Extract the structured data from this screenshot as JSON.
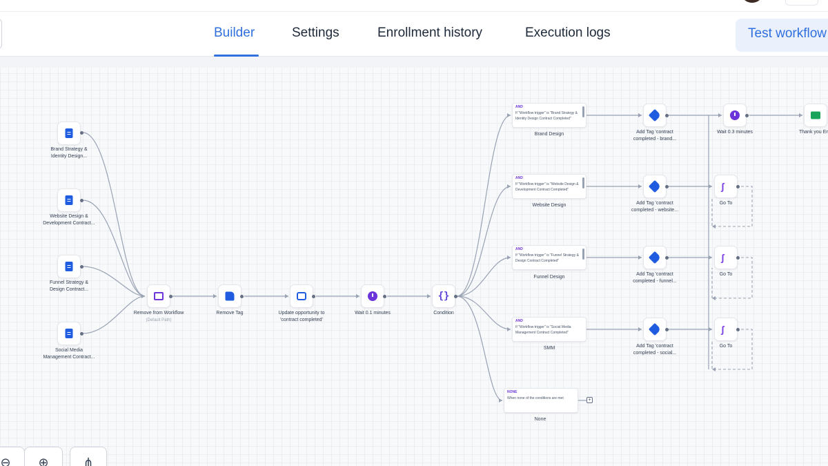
{
  "header": {
    "tabs": [
      {
        "label": "Builder",
        "active": true
      },
      {
        "label": "Settings",
        "active": false
      },
      {
        "label": "Enrollment history",
        "active": false
      },
      {
        "label": "Execution logs",
        "active": false
      }
    ],
    "test_button": "Test workflow"
  },
  "triggers": [
    {
      "label1": "Brand Strategy &",
      "label2": "Identity Design...",
      "icon": "document-icon"
    },
    {
      "label1": "Website Design &",
      "label2": "Development Contract...",
      "icon": "document-icon"
    },
    {
      "label1": "Funnel Strategy &",
      "label2": "Design Contract...",
      "icon": "document-icon"
    },
    {
      "label1": "Social Media",
      "label2": "Management Contract...",
      "icon": "document-icon"
    }
  ],
  "main_actions": [
    {
      "label1": "Remove from Workflow",
      "label2": "(Default Path)",
      "icon": "remove-workflow-icon"
    },
    {
      "label1": "Remove Tag",
      "label2": "",
      "icon": "remove-tag-icon"
    },
    {
      "label1": "Update opportunity to",
      "label2": "'contract completed'",
      "icon": "update-opportunity-icon"
    },
    {
      "label1": "Wait 0.1 minutes",
      "label2": "",
      "icon": "clock-icon"
    },
    {
      "label1": "Condition",
      "label2": "",
      "icon": "condition-icon"
    }
  ],
  "branches": [
    {
      "badge": "AND",
      "condition_text": "If \"Workflow trigger\" is \"Brand Strategy & Identity Design Contract Completed\"",
      "name": "Brand Design",
      "tag_label1": "Add Tag 'contract",
      "tag_label2": "completed - brand..."
    },
    {
      "badge": "AND",
      "condition_text": "If \"Workflow trigger\" is \"Website Design & Development Contract Completed\"",
      "name": "Website Design",
      "tag_label1": "Add Tag 'contract",
      "tag_label2": "completed - website..."
    },
    {
      "badge": "AND",
      "condition_text": "If \"Workflow trigger\" is \"Funnel Strategy & Design Contract Completed\"",
      "name": "Funnel Design",
      "tag_label1": "Add Tag 'contract",
      "tag_label2": "completed - funnel..."
    },
    {
      "badge": "AND",
      "condition_text": "If \"Workflow trigger\" is \"Social Media Management Contract Completed\"",
      "name": "SMM",
      "tag_label1": "Add Tag 'contract",
      "tag_label2": "completed - social..."
    }
  ],
  "none_branch": {
    "badge": "NONE",
    "condition_text": "When none of the conditions are met",
    "name": "None"
  },
  "wait_after": "Wait 0.3 minutes",
  "thank_you": "Thank you Em",
  "goto_label": "Go To",
  "zoom_controls": [
    "zoom-out",
    "zoom-in",
    "auto-layout"
  ]
}
